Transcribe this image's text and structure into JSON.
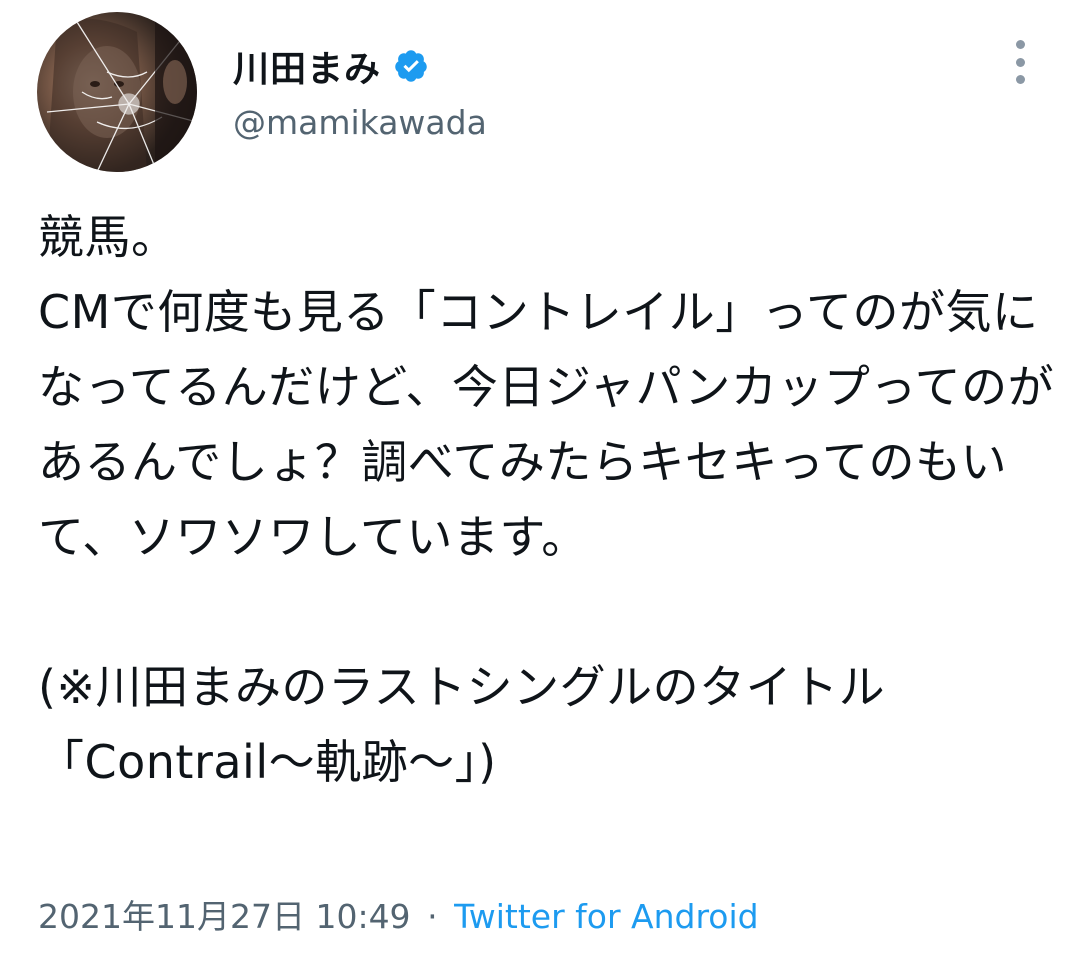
{
  "tweet": {
    "author": {
      "display_name": "川田まみ",
      "handle": "@mamikawada",
      "verified": true
    },
    "body": "競馬。\nCMで何度も見る「コントレイル」ってのが気になってるんだけど、今日ジャパンカップってのがあるんでしょ？調べてみたらキセキってのもいて、ソワソワしています。\n\n(※川田まみのラストシングルのタイトル「Contrail〜軌跡〜」)",
    "timestamp": "2021年11月27日 10:49",
    "separator": "·",
    "source": "Twitter for Android"
  },
  "icons": {
    "avatar": "profile-photo",
    "verified": "verified-badge-icon",
    "more": "more-options-icon"
  },
  "colors": {
    "text_primary": "#0f1419",
    "text_secondary": "#536471",
    "link": "#1d9bf0",
    "verified_badge": "#1d9bf0"
  }
}
